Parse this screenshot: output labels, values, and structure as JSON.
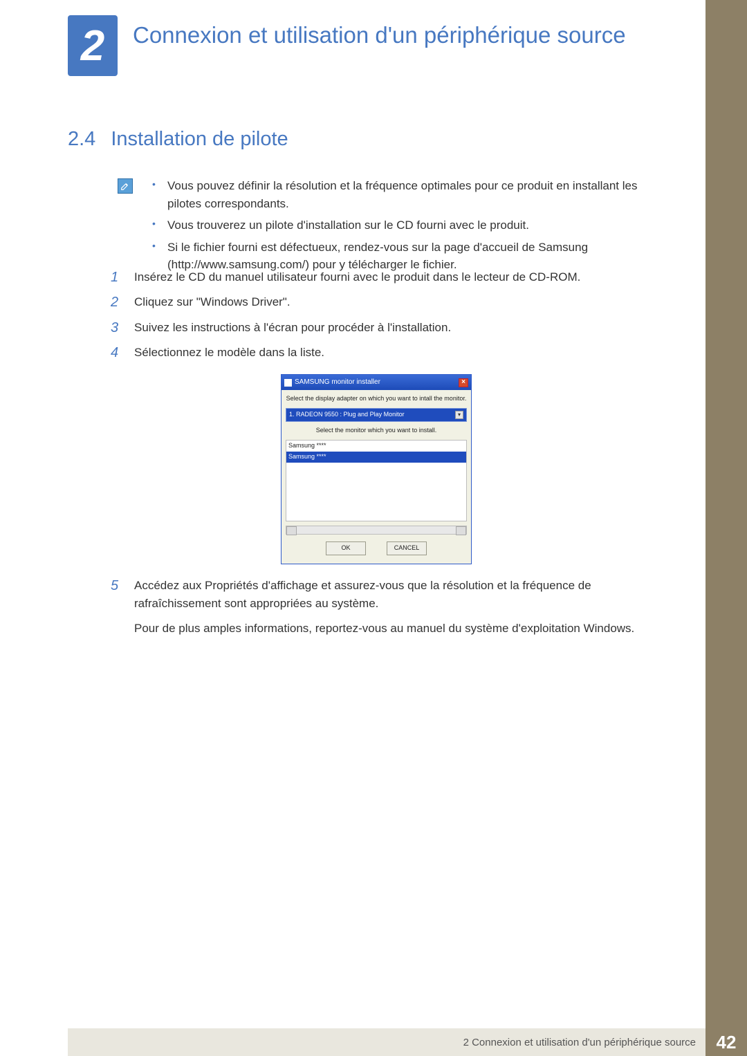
{
  "chapter": {
    "number": "2",
    "title": "Connexion et utilisation d'un périphérique source"
  },
  "section": {
    "number": "2.4",
    "title": "Installation de pilote"
  },
  "note": {
    "icon": "pencil-note-icon",
    "items": [
      "Vous pouvez définir la résolution et la fréquence optimales pour ce produit en installant les pilotes correspondants.",
      "Vous trouverez un pilote d'installation sur le CD fourni avec le produit.",
      "Si le fichier fourni est défectueux, rendez-vous sur la page d'accueil de Samsung (http://www.samsung.com/) pour y télécharger le fichier."
    ]
  },
  "steps": [
    {
      "n": "1",
      "text": "Insérez le CD du manuel utilisateur fourni avec le produit dans le lecteur de CD-ROM."
    },
    {
      "n": "2",
      "text": "Cliquez sur \"Windows Driver\"."
    },
    {
      "n": "3",
      "text": "Suivez les instructions à l'écran pour procéder à l'installation."
    },
    {
      "n": "4",
      "text": "Sélectionnez le modèle dans la liste."
    },
    {
      "n": "5",
      "text": "Accédez aux Propriétés d'affichage et assurez-vous que la résolution et la fréquence de rafraîchissement sont appropriées au système."
    },
    {
      "n": "",
      "text": "Pour de plus amples informations, reportez-vous au manuel du système d'exploitation Windows."
    }
  ],
  "installer": {
    "title": "SAMSUNG monitor installer",
    "instr1": "Select the display adapter on which you want to intall the monitor.",
    "dropdown": "1. RADEON 9550 : Plug and Play Monitor",
    "instr2": "Select the monitor which you want to install.",
    "rows": [
      "Samsung ****",
      "Samsung ****"
    ],
    "ok": "OK",
    "cancel": "CANCEL"
  },
  "footer": {
    "text": "2 Connexion et utilisation d'un périphérique source",
    "page": "42"
  }
}
